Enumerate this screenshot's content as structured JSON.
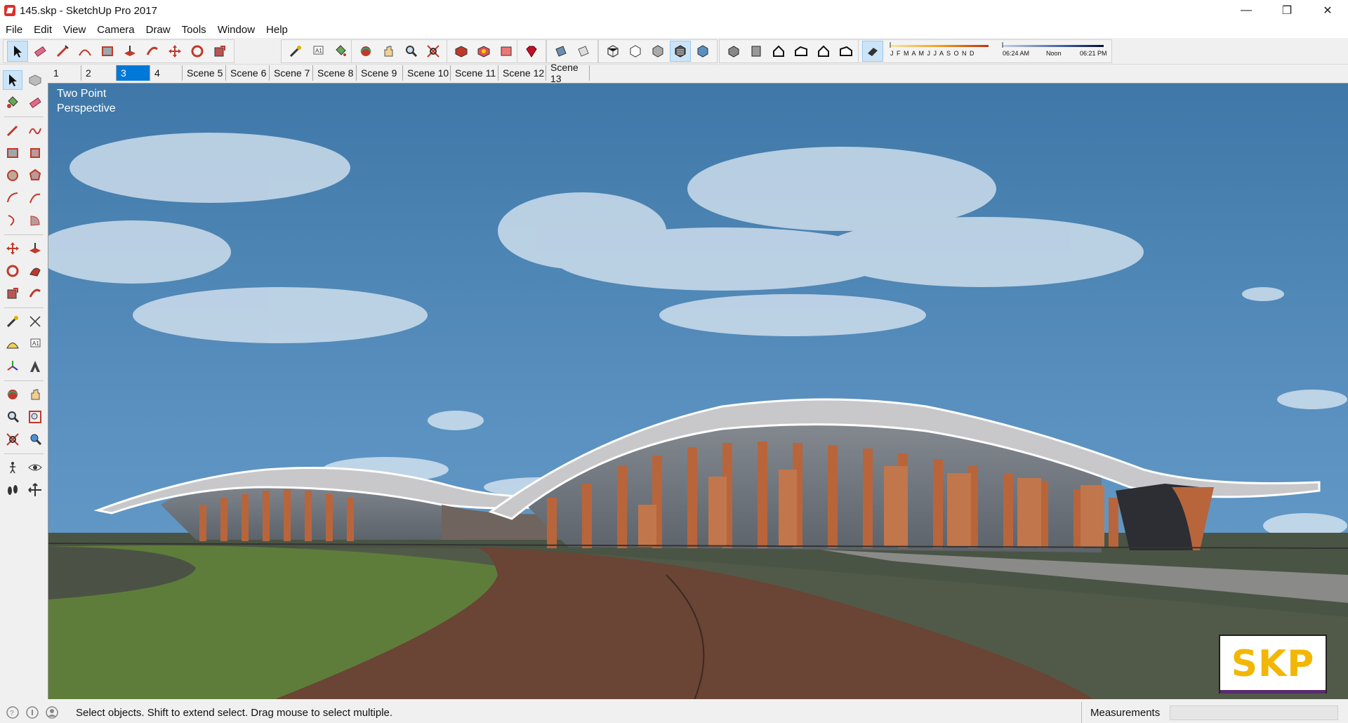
{
  "window": {
    "title": "145.skp - SketchUp Pro 2017",
    "minimize": "—",
    "restore": "❐",
    "close": "✕"
  },
  "menu": [
    "File",
    "Edit",
    "View",
    "Camera",
    "Draw",
    "Tools",
    "Window",
    "Help"
  ],
  "shadows": {
    "months": "J F M A M J J A S O N D",
    "time_start": "06:24 AM",
    "time_mid": "Noon",
    "time_end": "06:21 PM"
  },
  "scenes": [
    {
      "label": "1",
      "active": false
    },
    {
      "label": "2",
      "active": false
    },
    {
      "label": "3",
      "active": true
    },
    {
      "label": "4",
      "active": false
    },
    {
      "label": "Scene 5",
      "active": false
    },
    {
      "label": "Scene 6",
      "active": false
    },
    {
      "label": "Scene 7",
      "active": false
    },
    {
      "label": "Scene 8",
      "active": false
    },
    {
      "label": "Scene 9",
      "active": false
    },
    {
      "label": "Scene 10",
      "active": false
    },
    {
      "label": "Scene 11",
      "active": false
    },
    {
      "label": "Scene 12",
      "active": false
    },
    {
      "label": "Scene 13",
      "active": false
    }
  ],
  "viewport": {
    "camera_line1": "Two Point",
    "camera_line2": "Perspective",
    "logo": "SKP"
  },
  "status": {
    "text": "Select objects. Shift to extend select. Drag mouse to select multiple.",
    "measurements_label": "Measurements",
    "measurements_value": ""
  },
  "colors": {
    "accent": "#0078d7",
    "sky": "#4f86b5",
    "roof": "#ffffff",
    "columns": "#b8653c",
    "lawn": "#5f7d3a",
    "path": "#6a4434"
  }
}
